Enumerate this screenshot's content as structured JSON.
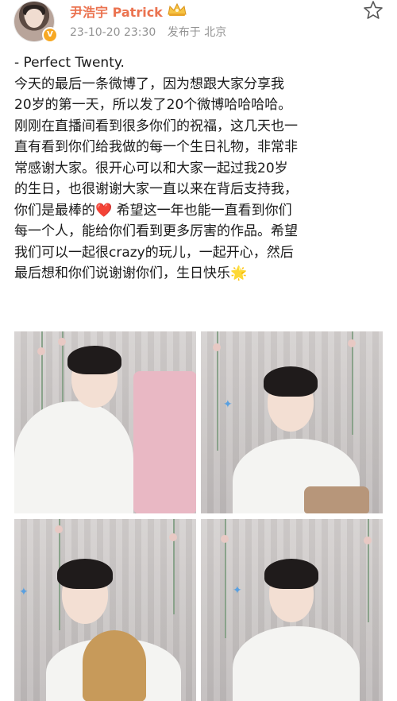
{
  "post": {
    "author": "尹浩宇 Patrick",
    "date": "23-10-20 23:30",
    "location": "发布于 北京",
    "lines": [
      "- Perfect Twenty.",
      "今天的最后一条微博了，因为想跟大家分享我",
      "20岁的第一天，所以发了20个微博哈哈哈哈。",
      "刚刚在直播间看到很多你们的祝福，这几天也一",
      "直有看到你们给我做的每一个生日礼物，非常非",
      "常感谢大家。很开心可以和大家一起过我20岁",
      "的生日，也很谢谢大家一直以来在背后支持我，",
      "你们是最棒的",
      " 希望这一年也能一直看到你们",
      "每一个人，能给你们看到更多厉害的作品。希望",
      "我们可以一起很crazy的玩儿，一起开心，然后",
      "最后想和你们说谢谢你们，生日快乐"
    ],
    "heart_emoji": "❤️",
    "sparkle_emoji": "🌟"
  },
  "icons": {
    "avatar_badge": "V",
    "crown": "crown-badge-icon",
    "star": "favorite-star-icon"
  },
  "colors": {
    "username": "#eb7350",
    "meta": "#939393",
    "text": "#1a1a1a",
    "badge": "#f7a823"
  }
}
